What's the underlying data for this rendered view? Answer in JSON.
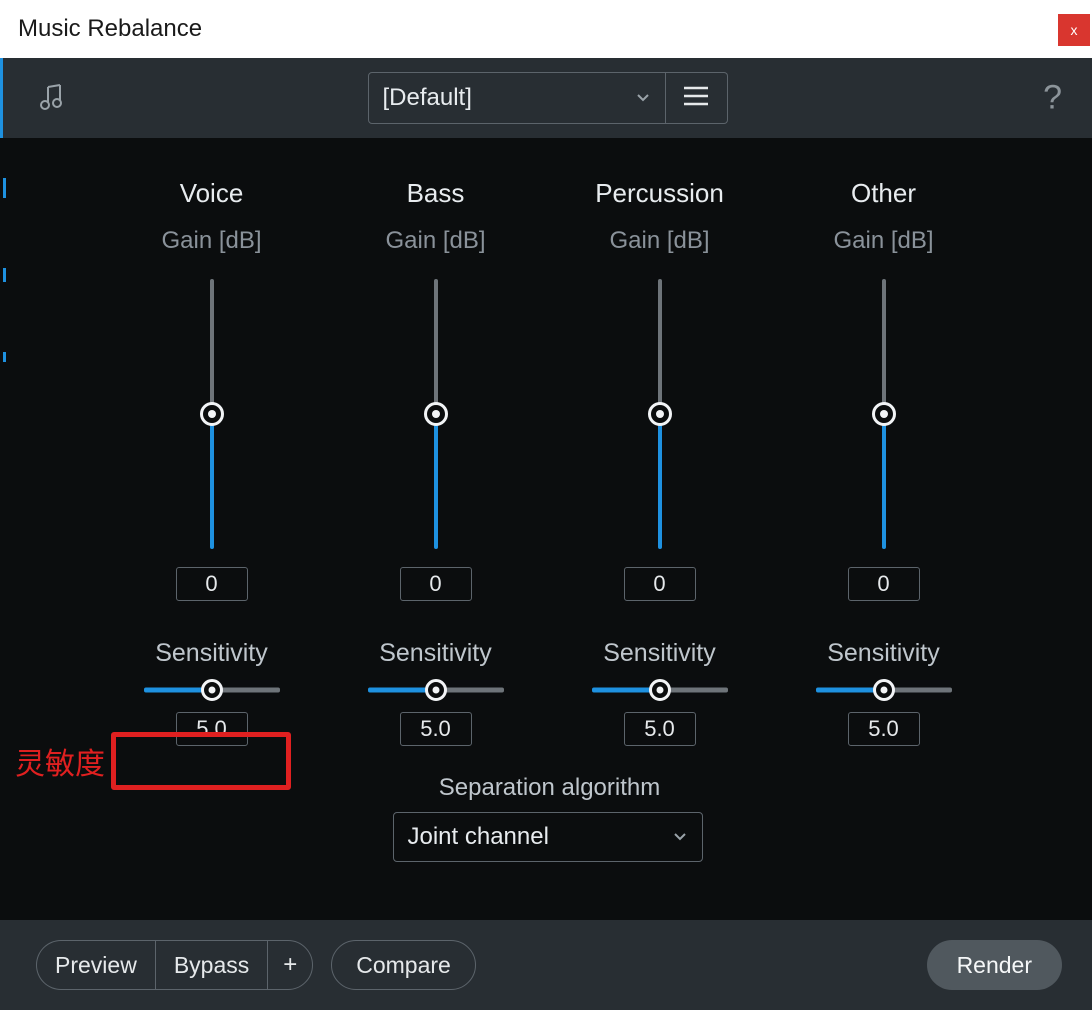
{
  "window": {
    "title": "Music Rebalance",
    "close_label": "x"
  },
  "toolbar": {
    "preset": "[Default]",
    "help_label": "?"
  },
  "annotation": {
    "cn_label": "灵敏度"
  },
  "channels": [
    {
      "name": "Voice",
      "gain_label": "Gain [dB]",
      "gain_value": "0",
      "sens_label": "Sensitivity",
      "sens_value": "5.0"
    },
    {
      "name": "Bass",
      "gain_label": "Gain [dB]",
      "gain_value": "0",
      "sens_label": "Sensitivity",
      "sens_value": "5.0"
    },
    {
      "name": "Percussion",
      "gain_label": "Gain [dB]",
      "gain_value": "0",
      "sens_label": "Sensitivity",
      "sens_value": "5.0"
    },
    {
      "name": "Other",
      "gain_label": "Gain [dB]",
      "gain_value": "0",
      "sens_label": "Sensitivity",
      "sens_value": "5.0"
    }
  ],
  "separation": {
    "label": "Separation algorithm",
    "value": "Joint channel"
  },
  "footer": {
    "preview": "Preview",
    "bypass": "Bypass",
    "plus": "+",
    "compare": "Compare",
    "render": "Render"
  }
}
